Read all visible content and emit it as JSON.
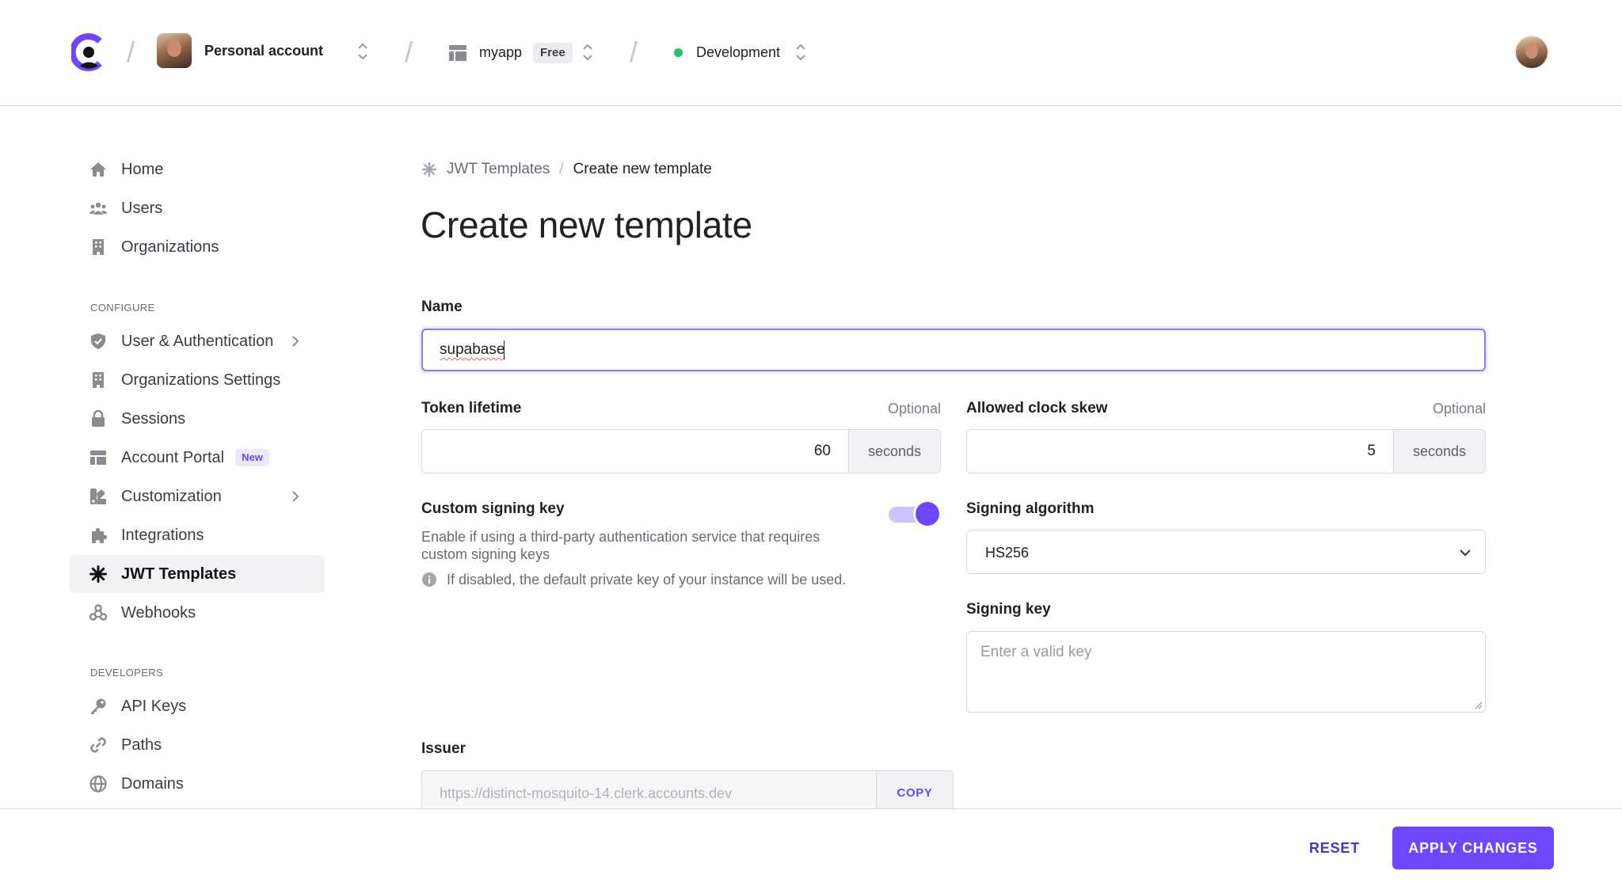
{
  "header": {
    "account_label": "Personal account",
    "app_label": "myapp",
    "plan_badge": "Free",
    "environment_label": "Development",
    "environment_status_color": "#22c55e"
  },
  "sidebar": {
    "items_top": [
      {
        "label": "Home",
        "icon": "home-icon"
      },
      {
        "label": "Users",
        "icon": "users-icon"
      },
      {
        "label": "Organizations",
        "icon": "building-icon"
      }
    ],
    "configure_title": "CONFIGURE",
    "items_configure": [
      {
        "label": "User & Authentication",
        "icon": "shield-icon",
        "has_chevron": true
      },
      {
        "label": "Organizations Settings",
        "icon": "building-icon"
      },
      {
        "label": "Sessions",
        "icon": "lock-icon"
      },
      {
        "label": "Account Portal",
        "icon": "layout-icon",
        "badge": "New"
      },
      {
        "label": "Customization",
        "icon": "palette-icon",
        "has_chevron": true
      },
      {
        "label": "Integrations",
        "icon": "puzzle-icon"
      },
      {
        "label": "JWT Templates",
        "icon": "asterisk-icon",
        "active": true
      },
      {
        "label": "Webhooks",
        "icon": "webhook-icon"
      }
    ],
    "developers_title": "DEVELOPERS",
    "items_developers": [
      {
        "label": "API Keys",
        "icon": "key-icon"
      },
      {
        "label": "Paths",
        "icon": "link-icon"
      },
      {
        "label": "Domains",
        "icon": "globe-icon"
      }
    ]
  },
  "breadcrumb": {
    "parent": "JWT Templates",
    "separator": "/",
    "current": "Create new template"
  },
  "page_title": "Create new template",
  "form": {
    "name": {
      "label": "Name",
      "value": "supabase"
    },
    "token_lifetime": {
      "label": "Token lifetime",
      "optional": "Optional",
      "value": "60",
      "unit": "seconds"
    },
    "clock_skew": {
      "label": "Allowed clock skew",
      "optional": "Optional",
      "value": "5",
      "unit": "seconds"
    },
    "custom_signing_key": {
      "label": "Custom signing key",
      "enabled": true,
      "help": "Enable if using a third-party authentication service that requires custom signing keys",
      "info": "If disabled, the default private key of your instance will be used."
    },
    "signing_algorithm": {
      "label": "Signing algorithm",
      "value": "HS256"
    },
    "signing_key": {
      "label": "Signing key",
      "placeholder": "Enter a valid key"
    },
    "issuer": {
      "label": "Issuer",
      "value": "https://distinct-mosquito-14.clerk.accounts.dev",
      "copy_label": "COPY"
    }
  },
  "footer": {
    "reset_label": "RESET",
    "apply_label": "APPLY CHANGES"
  },
  "colors": {
    "accent": "#6c47ff",
    "text": "#212126",
    "muted": "#6b6b75",
    "border": "#d9d9de"
  }
}
